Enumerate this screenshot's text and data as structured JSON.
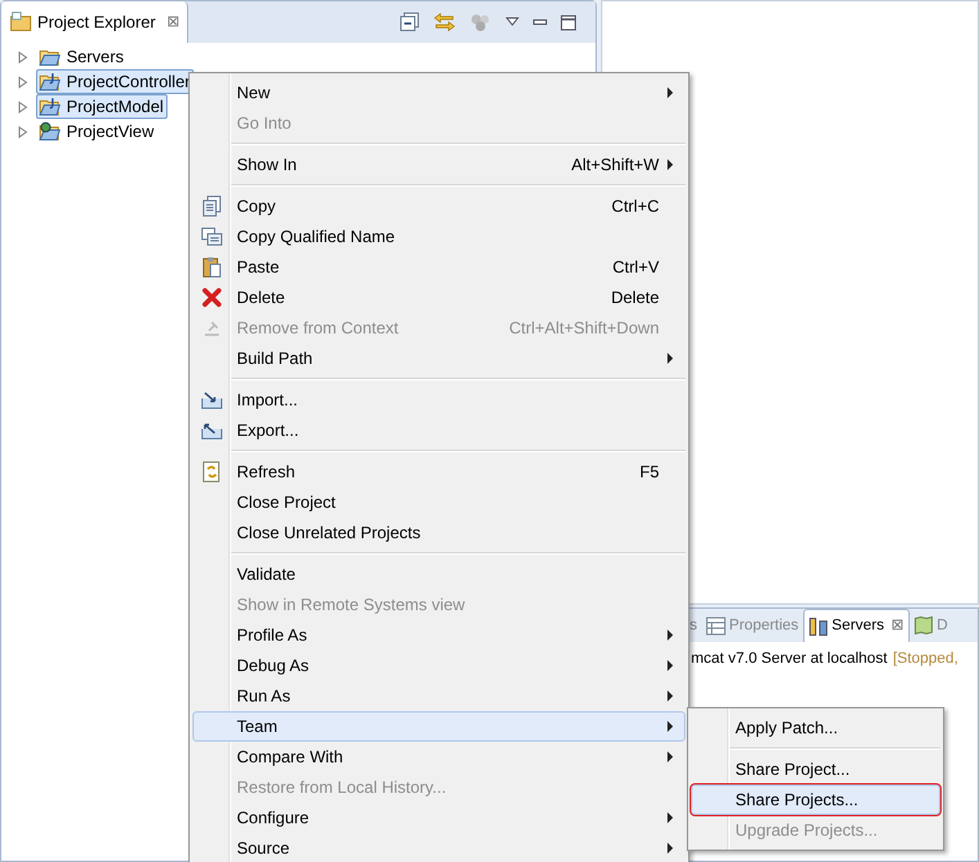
{
  "explorer": {
    "title": "Project Explorer",
    "close": "⊠",
    "items": [
      {
        "label": "Servers",
        "selected": false
      },
      {
        "label": "ProjectController",
        "selected": true
      },
      {
        "label": "ProjectModel",
        "selected": true
      },
      {
        "label": "ProjectView",
        "selected": false
      }
    ]
  },
  "servers_panel": {
    "tabs": [
      {
        "label": "s",
        "selected": false
      },
      {
        "label": "Properties",
        "selected": false
      },
      {
        "label": "Servers",
        "selected": true,
        "close": "⊠"
      },
      {
        "label": "D",
        "selected": false
      }
    ],
    "row": {
      "name": "mcat v7.0 Server at localhost",
      "status": "[Stopped, "
    }
  },
  "context_menu": {
    "items": [
      {
        "kind": "item",
        "label": "New",
        "submenu": true,
        "disabled": false,
        "selected": false
      },
      {
        "kind": "item",
        "label": "Go Into",
        "disabled": true,
        "selected": false
      },
      {
        "kind": "separator"
      },
      {
        "kind": "item",
        "label": "Show In",
        "shortcut": "Alt+Shift+W",
        "submenu": true,
        "disabled": false,
        "selected": false
      },
      {
        "kind": "separator"
      },
      {
        "kind": "item",
        "label": "Copy",
        "shortcut": "Ctrl+C",
        "disabled": false,
        "selected": false
      },
      {
        "kind": "item",
        "label": "Copy Qualified Name",
        "disabled": false,
        "selected": false
      },
      {
        "kind": "item",
        "label": "Paste",
        "shortcut": "Ctrl+V",
        "disabled": false,
        "selected": false
      },
      {
        "kind": "item",
        "label": "Delete",
        "shortcut": "Delete",
        "disabled": false,
        "selected": false
      },
      {
        "kind": "item",
        "label": "Remove from Context",
        "shortcut": "Ctrl+Alt+Shift+Down",
        "disabled": true,
        "selected": false
      },
      {
        "kind": "item",
        "label": "Build Path",
        "submenu": true,
        "disabled": false,
        "selected": false
      },
      {
        "kind": "separator"
      },
      {
        "kind": "item",
        "label": "Import...",
        "disabled": false,
        "selected": false
      },
      {
        "kind": "item",
        "label": "Export...",
        "disabled": false,
        "selected": false
      },
      {
        "kind": "separator"
      },
      {
        "kind": "item",
        "label": "Refresh",
        "shortcut": "F5",
        "disabled": false,
        "selected": false
      },
      {
        "kind": "item",
        "label": "Close Project",
        "disabled": false,
        "selected": false
      },
      {
        "kind": "item",
        "label": "Close Unrelated Projects",
        "disabled": false,
        "selected": false
      },
      {
        "kind": "separator"
      },
      {
        "kind": "item",
        "label": "Validate",
        "disabled": false,
        "selected": false
      },
      {
        "kind": "item",
        "label": "Show in Remote Systems view",
        "disabled": true,
        "selected": false
      },
      {
        "kind": "item",
        "label": "Profile As",
        "submenu": true,
        "disabled": false,
        "selected": false
      },
      {
        "kind": "item",
        "label": "Debug As",
        "submenu": true,
        "disabled": false,
        "selected": false
      },
      {
        "kind": "item",
        "label": "Run As",
        "submenu": true,
        "disabled": false,
        "selected": false
      },
      {
        "kind": "item",
        "label": "Team",
        "submenu": true,
        "disabled": false,
        "selected": true
      },
      {
        "kind": "item",
        "label": "Compare With",
        "submenu": true,
        "disabled": false,
        "selected": false
      },
      {
        "kind": "item",
        "label": "Restore from Local History...",
        "disabled": true,
        "selected": false
      },
      {
        "kind": "item",
        "label": "Configure",
        "submenu": true,
        "disabled": false,
        "selected": false
      },
      {
        "kind": "item",
        "label": "Source",
        "submenu": true,
        "disabled": false,
        "selected": false
      }
    ]
  },
  "team_submenu": {
    "items": [
      {
        "kind": "item",
        "label": "Apply Patch...",
        "disabled": false,
        "selected": false
      },
      {
        "kind": "separator"
      },
      {
        "kind": "item",
        "label": "Share Project...",
        "disabled": false,
        "selected": false
      },
      {
        "kind": "item",
        "label": "Share Projects...",
        "disabled": false,
        "selected": true,
        "outlined": true
      },
      {
        "kind": "item",
        "label": "Upgrade Projects...",
        "disabled": true,
        "selected": false
      }
    ]
  }
}
